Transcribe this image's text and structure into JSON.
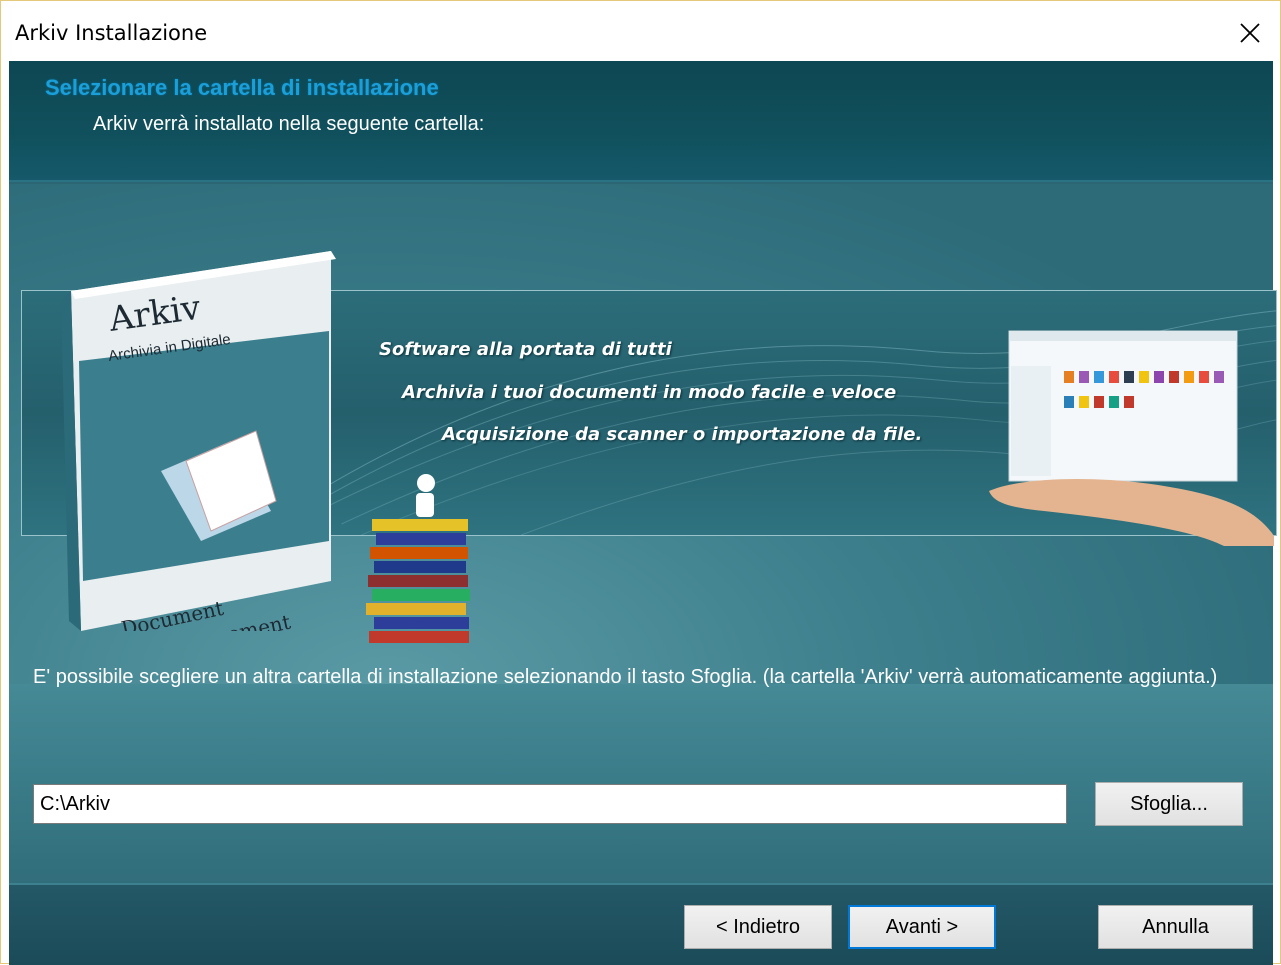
{
  "window": {
    "title": "Arkiv Installazione"
  },
  "header": {
    "title": "Selezionare la cartella di installazione",
    "subtitle": "Arkiv verrà installato nella seguente cartella:"
  },
  "banner": {
    "box_brand": "Arkiv",
    "box_tagline": "Archivia in Digitale",
    "box_bottom_line1": "Document",
    "box_bottom_line2": "Management",
    "taglines": [
      "Software alla portata di tutti",
      "Archivia i tuoi documenti in modo facile e veloce",
      "Acquisizione da scanner o importazione da file."
    ]
  },
  "info": {
    "text": "E' possibile scegliere un altra cartella di installazione selezionando il tasto Sfoglia. (la cartella 'Arkiv' verrà automaticamente aggiunta.)"
  },
  "path": {
    "value": "C:\\Arkiv"
  },
  "buttons": {
    "browse": "Sfoglia...",
    "back": "< Indietro",
    "next": "Avanti >",
    "cancel": "Annulla"
  },
  "colors": {
    "header_title": "#1a9fd8",
    "header_bg": "#0d4753",
    "body_bg": "#2d6a78",
    "focus_border": "#0078d7"
  },
  "icons": {
    "close": "close-icon"
  }
}
